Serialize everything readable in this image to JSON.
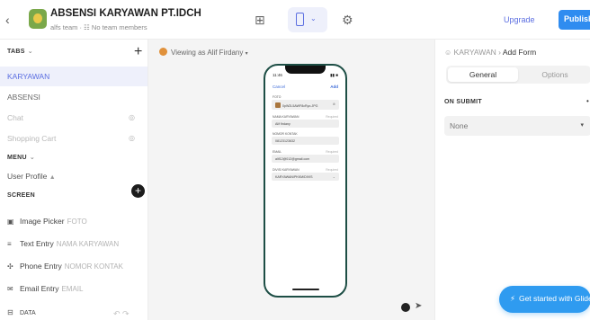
{
  "app": {
    "title": "ABSENSI KARYAWAN PT.IDCH",
    "subtitle": "alfs team · ☷ No team members"
  },
  "toolbar": {
    "upgrade_label": "Upgrade",
    "publish_label": "Publish"
  },
  "left": {
    "tabs_header": "TABS",
    "tabs": [
      {
        "label": "KARYAWAN",
        "state": "active"
      },
      {
        "label": "ABSENSI",
        "state": "normal"
      },
      {
        "label": "Chat",
        "state": "hidden"
      },
      {
        "label": "Shopping Cart",
        "state": "hidden"
      }
    ],
    "menu_header": "MENU",
    "menu_item": "User Profile",
    "screen_header": "SCREEN",
    "components": [
      {
        "icon": "image-icon",
        "label": "Image Picker",
        "binding": "FOTO"
      },
      {
        "icon": "text-icon",
        "label": "Text Entry",
        "binding": "NAMA KARYAWAN"
      },
      {
        "icon": "phone-icon",
        "label": "Phone Entry",
        "binding": "NOMOR KONTAK"
      },
      {
        "icon": "email-icon",
        "label": "Email Entry",
        "binding": "EMAIL"
      }
    ],
    "data_header": "DATA"
  },
  "canvas": {
    "viewing_as": "Viewing as Alif Firdany",
    "phone": {
      "time": "11:46",
      "status": "▮▮ ■",
      "cancel": "Cancel",
      "add": "Add",
      "fields": [
        {
          "label": "FOTO",
          "value": "0pW2L5AWF8cRyo.JPG",
          "required": "",
          "kind": "image"
        },
        {
          "label": "NAMA KARYAWAN",
          "value": "Alif firdany",
          "required": "Required",
          "kind": "text"
        },
        {
          "label": "NOMOR KONTAK",
          "value": "08123123632",
          "required": "",
          "kind": "text"
        },
        {
          "label": "EMAIL",
          "value": "alif12@012@gmail.com",
          "required": "Required",
          "kind": "text"
        },
        {
          "label": "DIVISI KARYAWAN",
          "value": "KARYAWAN/PKKM/DIVIS",
          "required": "Required",
          "kind": "select"
        }
      ]
    }
  },
  "right": {
    "breadcrumb_root": "KARYAWAN",
    "breadcrumb_current": "Add Form",
    "tab_general": "General",
    "tab_options": "Options",
    "on_submit": "ON SUBMIT",
    "on_submit_value": "None",
    "glide_cta": "Get started with Glide"
  },
  "colors": {
    "accent": "#5b6ee1",
    "publish": "#2f8cf0",
    "phone_frame": "#1d4e45",
    "active_tab_bg": "#eef0fb"
  }
}
